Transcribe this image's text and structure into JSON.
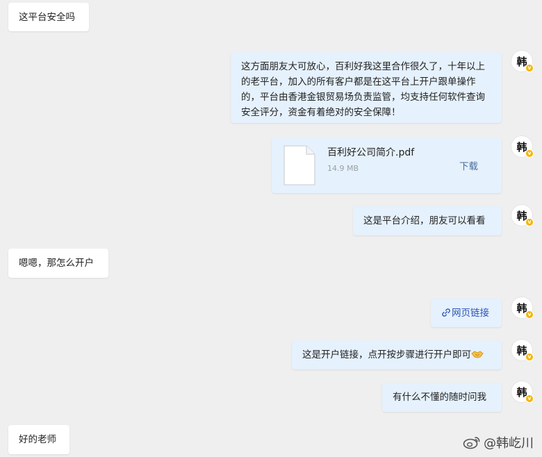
{
  "contact": {
    "avatar_char": "韩",
    "badge": "v"
  },
  "messages": {
    "m1": "这平台安全吗",
    "m2": "这方面朋友大可放心，百利好我这里合作很久了，十年以上的老平台，加入的所有客户都是在这平台上开户跟单操作的，平台由香港金银贸易场负责监管，均支持任何软件查询安全评分，资金有着绝对的安全保障！",
    "m4": "这是平台介绍，朋友可以看看",
    "m5": "嗯嗯，那怎么开户",
    "m7": "这是开户链接，点开按步骤进行开户即可",
    "m8": "有什么不懂的随时问我",
    "m9": "好的老师"
  },
  "file": {
    "name": "百利好公司简介.pdf",
    "size": "14.9 MB",
    "download_label": "下载"
  },
  "link": {
    "label": "网页链接"
  },
  "watermark": {
    "text": "@韩屹川"
  },
  "icons": {
    "file": "file-icon",
    "link": "link-icon",
    "handshake": "handshake-emoji",
    "weibo": "weibo-logo-icon"
  },
  "colors": {
    "background": "#efefef",
    "bubble_left": "#ffffff",
    "bubble_right": "#e5f1fc",
    "link": "#2c55b7",
    "badge": "#f6b400"
  }
}
